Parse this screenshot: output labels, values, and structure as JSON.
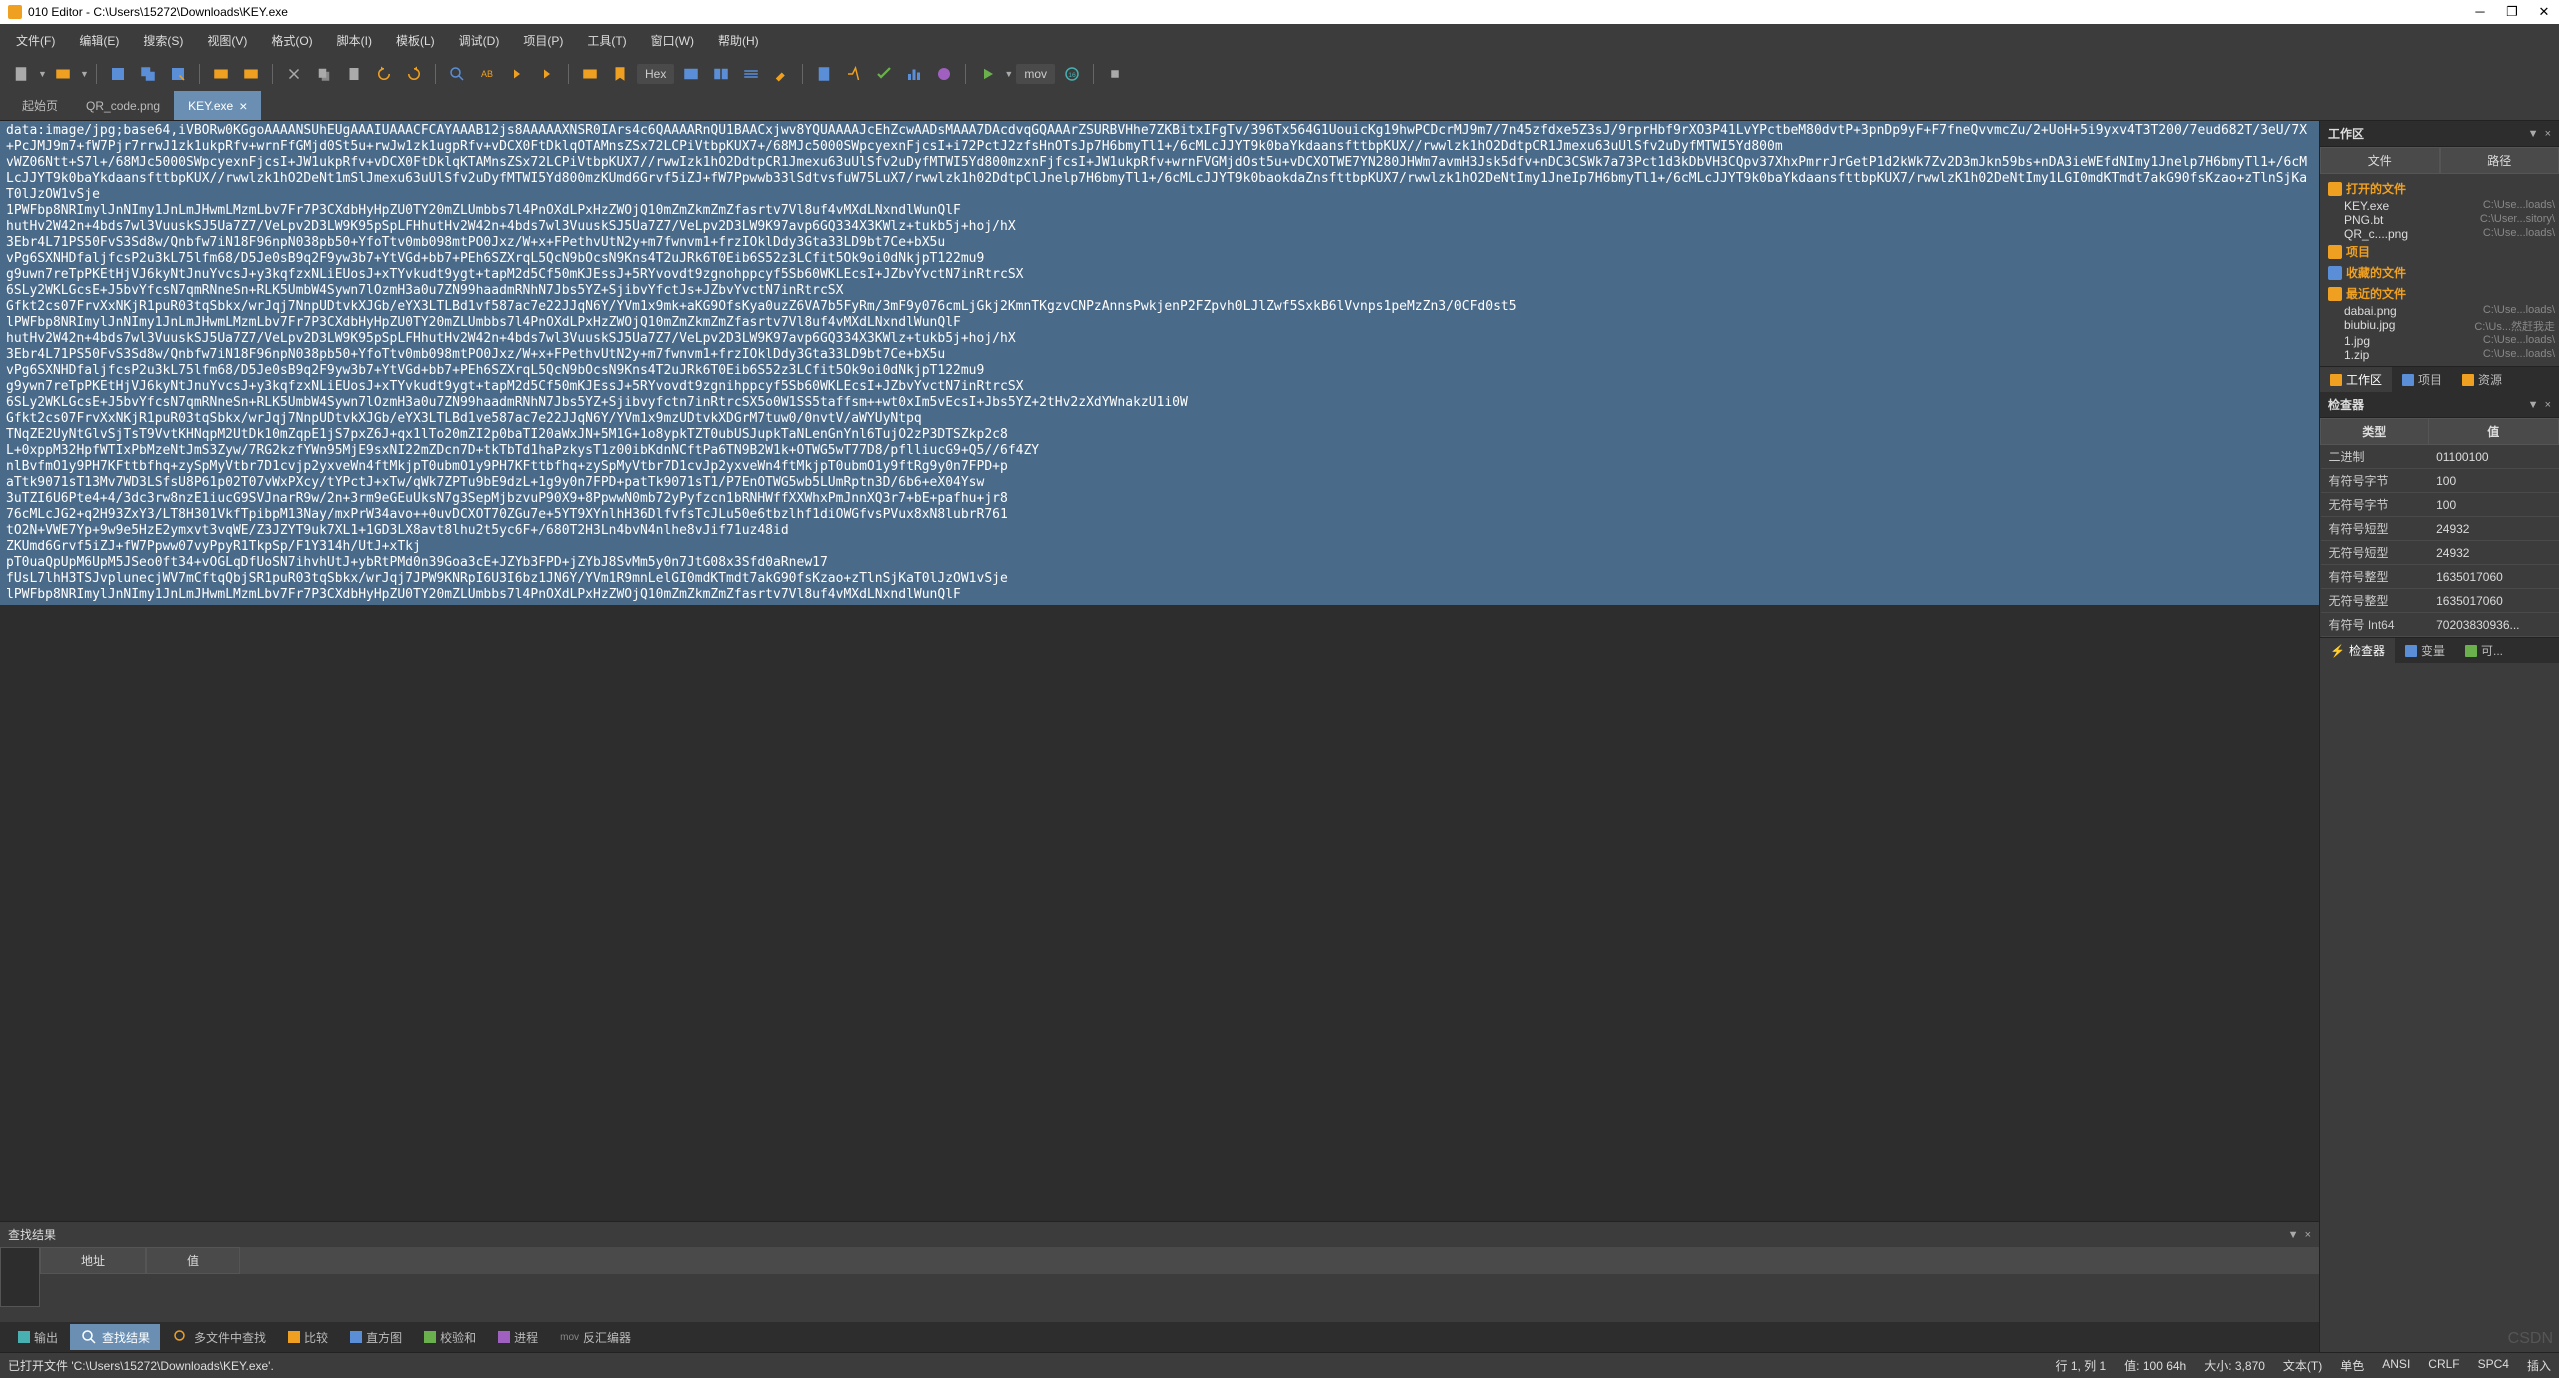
{
  "titlebar": {
    "text": "010 Editor - C:\\Users\\15272\\Downloads\\KEY.exe"
  },
  "menus": {
    "file": "文件(F)",
    "edit": "编辑(E)",
    "search": "搜索(S)",
    "view": "视图(V)",
    "format": "格式(O)",
    "script": "脚本(I)",
    "template": "模板(L)",
    "debug": "调试(D)",
    "project": "项目(P)",
    "tools": "工具(T)",
    "window": "窗口(W)",
    "help": "帮助(H)"
  },
  "toolbar": {
    "hex": "Hex",
    "mov": "mov"
  },
  "tabs": [
    {
      "label": "起始页",
      "active": false
    },
    {
      "label": "QR_code.png",
      "active": false
    },
    {
      "label": "KEY.exe",
      "active": true,
      "closeable": true
    }
  ],
  "content": "data:image/jpg;base64,iVBORw0KGgoAAAANSUhEUgAAAIUAAACFCAYAAAB12js8AAAAAXNSR0IArs4c6QAAAARnQU1BAACxjwv8YQUAAAAJcEhZcwAADsMAAA7DAcdvqGQAAArZSURBVHhe7ZKBitxIFgTv/396Tx564G1UouicKg19hwPCDcrMJ9m7/7n45zfdxe5Z3sJ/9rprHbf9rXO3P41LvYPctbeM80dvtP+3pnDp9yF+F7fneQvvmcZu/2+UoH+5i9yxv4T3T200/7eud682T/3eU/7X+PcJMJ9m7+fW7Pjr7rrwJ1zk1ukpRfv+wrnFfGMjd0St5u+rwJw1zk1ugpRfv+vDCX0FtDklqOTAMnsZSx72LCPiVtbpKUX7+/68MJc5000SWpcyexnFjcsI+i72PctJ2zfsHnOTsJp7H6bmyTl1+/6cMLcJJYT9k0baYkdaansfttbpKUX//rwwlzk1hO2DdtpCR1Jmexu63uUlSfv2uDyfMTWI5Yd800m\nvWZ06Ntt+S7l+/68MJc5000SWpcyexnFjcsI+JW1ukpRfv+vDCX0FtDklqKTAMnsZSx72LCPiVtbpKUX7//rwwIzk1hO2DdtpCR1Jmexu63uUlSfv2uDyfMTWI5Yd800mzxnFjfcsI+JW1ukpRfv+wrnFVGMjdOst5u+vDCXOTWE7YN280JHWm7avmH3Jsk5dfv+nDC3CSWk7a73Pct1d3kDbVH3CQpv37XhxPmrrJrGetP1d2kWk7Zv2D3mJkn59bs+nDA3ieWEfdNImy1Jnelp7H6bmyTl1+/6cMLcJJYT9k0baYkdaansfttbpKUX//rwwlzk1hO2DeNt1mSlJmexu63uUlSfv2uDyfMTWI5Yd800mzKUmd6Grvf5iZJ+fW7Ppwwb33lSdtvsfuW75LuX7/rwwlzk1h02DdtpClJnelp7H6bmyTl1+/6cMLcJJYT9k0baokdaZnsfttbpKUX7/rwwlzk1hO2DeNtImy1JneIp7H6bmyTl1+/6cMLcJJYT9k0baYkdaansfttbpKUX7/rwwlzK1h02DeNtImy1LGI0mdKTmdt7akG90fsKzao+zTlnSjKaT0lJzOW1vSje\n1PWFbp8NRImylJnNImy1JnLmJHwmLMzmLbv7Fr7P3CXdbHyHpZU0TY20mZLUmbbs7l4PnOXdLPxHzZWOjQ10mZmZkmZmZfasrtv7Vl8uf4vMXdLNxndlWunQlF\nhutHv2W42n+4bds7wl3VuuskSJ5Ua7Z7/VeLpv2D3LW9K95pSpLFHhutHv2W42n+4bds7wl3VuuskSJ5Ua7Z7/VeLpv2D3LW9K97avp6GQ334X3KWlz+tukb5j+hoj/hX\n3Ebr4L71PS50FvS3Sd8w/Qnbfw7iN18F96npN038pb50+YfoTtv0mb098mtPO0Jxz/W+x+FPethvUtN2y+m7fwnvm1+frzIOklDdy3Gta33LD9bt7Ce+bX5u\nvPg6SXNHDfaljfcsP2u3kL75lfm68/D5Je0sB9q2F9yw3b7+YtVGd+bb7+PEh6SZXrqL5QcN9bOcsN9Kns4T2uJRk6T0Eib6S52z3LCfit5Ok9oi0dNkjpT122mu9\ng9uwn7reTpPKEtHjVJ6kyNtJnuYvcsJ+y3kqfzxNLiEUosJ+xTYvkudt9ygt+tapM2d5Cf50mKJEssJ+5RYvovdt9zgnohppcyf5Sb60WKLEcsI+JZbvYvctN7inRtrcSX\n6SLy2WKLGcsE+J5bvYfcsN7qmRNneSn+RLK5UmbW4Sywn7lOzmH3a0u7ZN99haadmRNhN7Jbs5YZ+SjibvYfctJs+JZbvYvctN7inRtrcSX\nGfkt2cs07FrvXxNKjR1puR03tqSbkx/wrJqj7NnpUDtvkXJGb/eYX3LTLBd1vf587ac7e22JJqN6Y/YVm1x9mk+aKG9OfsKya0uzZ6VA7b5FyRm/3mF9y076cmLjGkj2KmnTKgzvCNPzAnnsPwkjenP2FZpvh0LJlZwf5SxkB6lVvnps1peMzZn3/0CFd0st5\nlPWFbp8NRImylJnNImy1JnLmJHwmLMzmLbv7Fr7P3CXdbHyHpZU0TY20mZLUmbbs7l4PnOXdLPxHzZWOjQ10mZmZkmZmZfasrtv7Vl8uf4vMXdLNxndlWunQlF\nhutHv2W42n+4bds7wl3VuuskSJ5Ua7Z7/VeLpv2D3LW9K95pSpLFHhutHv2W42n+4bds7wl3VuuskSJ5Ua7Z7/VeLpv2D3LW9K97avp6GQ334X3KWlz+tukb5j+hoj/hX\n3Ebr4L71PS50FvS3Sd8w/Qnbfw7iN18F96npN038pb50+YfoTtv0mb098mtPO0Jxz/W+x+FPethvUtN2y+m7fwnvm1+frzIOklDdy3Gta33LD9bt7Ce+bX5u\nvPg6SXNHDfaljfcsP2u3kL75lfm68/D5Je0sB9q2F9yw3b7+YtVGd+bb7+PEh6SZXrqL5QcN9bOcsN9Kns4T2uJRk6T0Eib6S52z3LCfit5Ok9oi0dNkjpT122mu9\ng9ywn7reTpPKEtHjVJ6kyNtJnuYvcsJ+y3kqfzxNLiEUosJ+xTYvkudt9ygt+tapM2d5Cf50mKJEssJ+5RYvovdt9zgnihppcyf5Sb60WKLEcsI+JZbvYvctN7inRtrcSX\n6SLy2WKLGcsE+J5bvYfcsN7qmRNneSn+RLK5UmbW4Sywn7lOzmH3a0u7ZN99haadmRNhN7Jbs5YZ+Sjibvyfctn7inRtrcSX5o0W1SS5taffsm++wt0xIm5vEcsI+Jbs5YZ+2tHv2zXdYWnakzU1i0W\nGfkt2cs07FrvXxNKjR1puR03tqSbkx/wrJqj7NnpUDtvkXJGb/eYX3LTLBd1ve587ac7e22JJqN6Y/YVm1x9mzUDtvkXDGrM7tuw0/0nvtV/aWYUyNtpq\nTNqZE2UyNtGlvSjTsT9VvtKHNqpM2UtDk10mZqpE1jS7pxZ6J+qx1lTo20mZI2p0baTI20aWxJN+5M1G+1o8ypkTZT0ubUSJupkTaNLenGnYnl6TujO2zP3DTSZkp2c8\nL+0xppM32HpfWTIxPbMzeNtJmS3Zyw/7RG2kzfYWn95MjE9sxNI22mZDcn7D+tkTbTd1haPzkysT1z00ibKdnNCftPa6TN9B2W1k+OTWG5wT77D8/pflliucG9+Q5//6f4ZY\nnlBvfmO1y9PH7KFttbfhq+zySpMyVtbr7D1cvjp2yxveWn4ftMkjpT0ubmO1y9PH7KFttbfhq+zySpMyVtbr7D1cvJp2yxveWn4ftMkjpT0ubmO1y9ftRg9y0n7FPD+p\naTtk9071sT13Mv7WD3LSfsU8P61p02T07vWxPXcy/tYPctJ+xTw/qWk7ZPTu9bE9dzL+1g9y0n7FPD+patTk9071sT1/P7EnOTWG5wb5LUmRptn3D/6b6+eX04Ysw\n3uTZI6U6Pte4+4/3dc3rw8nzE1iucG9SVJnarR9w/2n+3rm9eGEuUksN7g3SepMjbzvuP90X9+8PpwwN0mb72yPyfzcn1bRNHWffXXWhxPmJnnXQ3r7+bE+pafhu+jr8\n76cMLcJG2+q2H93ZxY3/LT8H301VkfTpibpM13Nay/mxPrW34avo++0uvDCXOT70ZGu7e+5YT9XYnlhH36DlfvfsTcJLu50e6tbzlhf1diOWGfvsPVux8xN8lubrR761\ntO2N+VWE7Yp+9w9e5HzE2ymxvt3vqWE/Z3JZYT9uk7XL1+1GD3LX8avt8lhu2t5yc6F+/680T2H3Ln4bvN4nlhe8vJif71uz48id\nZKUmd6Grvf5iZJ+fW7Ppww07vyPpyR1TkpSp/F1Y314h/UtJ+xTkj\npT0uaQpUpM6UpM5JSeo0ft34+vOGLqDfUoSN7ihvhUtJ+ybRtPMd0n39Goa3cE+JZYb3FPD+jZYbJ8SvMm5y0n7JtG08x3Sfd0aRnew17\nfUsL7lhH3TSJvplunecjWV7mCftqQbjSR1puR03tqSbkx/wrJqj7JPW9KNRpI6U3I6bz1JN6Y/YVm1R9mnLelGI0mdKTmdt7akG90fsKzao+zTlnSjKaT0lJzOW1vSje\nlPWFbp8NRImylJnNImy1JnLmJHwmLMzmLbv7Fr7P3CXdbHyHpZU0TY20mZLUmbbs7l4PnOXdLPxHzZWOjQ10mZmZkmZmZfasrtv7Vl8uf4vMXdLNxndlWunQlF",
  "workspace": {
    "title": "工作区",
    "col_file": "文件",
    "col_path": "路径",
    "sections": {
      "open": "打开的文件",
      "project": "项目",
      "favorites": "收藏的文件",
      "recent": "最近的文件"
    },
    "open_files": [
      {
        "name": "KEY.exe",
        "path": "C:\\Use...loads\\"
      },
      {
        "name": "PNG.bt",
        "path": "C:\\User...sitory\\"
      },
      {
        "name": "QR_c....png",
        "path": "C:\\Use...loads\\"
      }
    ],
    "recent_files": [
      {
        "name": "dabai.png",
        "path": "C:\\Use...loads\\"
      },
      {
        "name": "biubiu.jpg",
        "path": "C:\\Us...然赶我走"
      },
      {
        "name": "1.jpg",
        "path": "C:\\Use...loads\\"
      },
      {
        "name": "1.zip",
        "path": "C:\\Use...loads\\"
      }
    ],
    "tabs": {
      "workspace": "工作区",
      "project": "项目",
      "resources": "资源"
    }
  },
  "inspector": {
    "title": "检查器",
    "col_type": "类型",
    "col_value": "值",
    "rows": [
      {
        "type": "二进制",
        "value": "01100100"
      },
      {
        "type": "有符号字节",
        "value": "100"
      },
      {
        "type": "无符号字节",
        "value": "100"
      },
      {
        "type": "有符号短型",
        "value": "24932"
      },
      {
        "type": "无符号短型",
        "value": "24932"
      },
      {
        "type": "有符号整型",
        "value": "1635017060"
      },
      {
        "type": "无符号整型",
        "value": "1635017060"
      },
      {
        "type": "有符号 Int64",
        "value": "70203830936..."
      }
    ],
    "tabs": {
      "inspector": "检查器",
      "variables": "变量",
      "targets": "可..."
    }
  },
  "search": {
    "title": "查找结果",
    "col_addr": "地址",
    "col_value": "值"
  },
  "bottom_tabs": {
    "output": "输出",
    "results": "查找结果",
    "find_in_files": "多文件中查找",
    "compare": "比较",
    "histogram": "直方图",
    "checksum": "校验和",
    "process": "进程",
    "disassembler": "反汇编器"
  },
  "statusbar": {
    "file": "已打开文件 'C:\\Users\\15272\\Downloads\\KEY.exe'.",
    "pos": "行 1, 列 1",
    "val": "值: 100 64h",
    "size": "大小: 3,870",
    "type": "文本(T)",
    "endian": "单色",
    "ansi": "ANSI",
    "crlf": "CRLF",
    "spc": "SPC4",
    "insert": "插入"
  },
  "watermark": "CSDN"
}
